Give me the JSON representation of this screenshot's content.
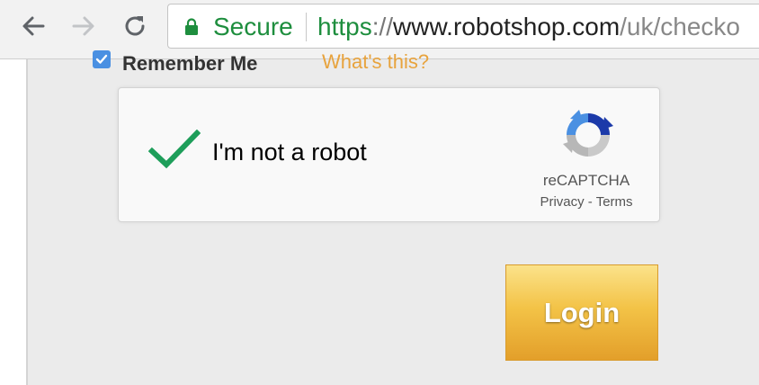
{
  "browser": {
    "secure_label": "Secure",
    "url": {
      "scheme": "https",
      "separator": "://",
      "host": "www.robotshop.com",
      "path": "/uk/checko"
    },
    "colors": {
      "secure": "#1e8e3e"
    }
  },
  "login_form": {
    "remember_me": {
      "label": "Remember Me",
      "checked": true
    },
    "whats_this": "What's this?",
    "login_label": "Login"
  },
  "recaptcha": {
    "label": "I'm not a robot",
    "verified": true,
    "brand": "reCAPTCHA",
    "privacy": "Privacy",
    "link_separator": " - ",
    "terms": "Terms"
  },
  "icons": [
    "back-arrow-icon",
    "forward-arrow-icon",
    "reload-icon",
    "lock-icon",
    "checkmark-icon",
    "recaptcha-logo-icon",
    "checkbox-check-icon"
  ]
}
